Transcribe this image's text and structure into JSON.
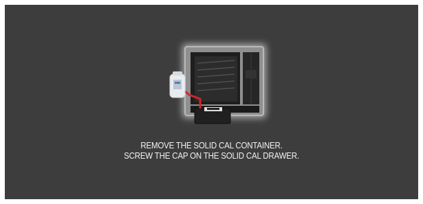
{
  "screen": {
    "background": "#3d3d3d",
    "illustration": {
      "icon": "oven-solid-cal-container-icon",
      "accent_color": "#d4262c"
    },
    "instructions": {
      "line1": "REMOVE THE SOLID CAL CONTAINER.",
      "line2": "SCREW THE CAP ON THE SOLID CAL DRAWER."
    }
  }
}
